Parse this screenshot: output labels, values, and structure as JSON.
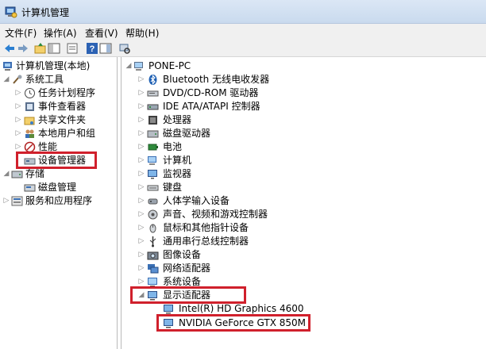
{
  "window": {
    "title": "计算机管理"
  },
  "menu": [
    "文件(F)",
    "操作(A)",
    "查看(V)",
    "帮助(H)"
  ],
  "toolbar": [
    "back-arrow-icon",
    "forward-arrow-icon",
    "up-folder-icon",
    "show-hide-tree-icon",
    "properties-icon",
    "help-icon",
    "view-icon",
    "scan-hardware-icon"
  ],
  "left_tree": [
    {
      "label": "计算机管理(本地)",
      "icon": "computer-management-icon"
    },
    {
      "label": "系统工具",
      "icon": "tools-icon"
    },
    {
      "label": "任务计划程序",
      "icon": "clock-icon"
    },
    {
      "label": "事件查看器",
      "icon": "event-viewer-icon"
    },
    {
      "label": "共享文件夹",
      "icon": "shared-folder-icon"
    },
    {
      "label": "本地用户和组",
      "icon": "users-icon"
    },
    {
      "label": "性能",
      "icon": "performance-icon"
    },
    {
      "label": "设备管理器",
      "icon": "device-manager-icon"
    },
    {
      "label": "存储",
      "icon": "storage-icon"
    },
    {
      "label": "磁盘管理",
      "icon": "disk-management-icon"
    },
    {
      "label": "服务和应用程序",
      "icon": "services-icon"
    }
  ],
  "device_tree": {
    "root": "PONE-PC",
    "categories": [
      "Bluetooth 无线电收发器",
      "DVD/CD-ROM 驱动器",
      "IDE ATA/ATAPI 控制器",
      "处理器",
      "磁盘驱动器",
      "电池",
      "计算机",
      "监视器",
      "键盘",
      "人体学输入设备",
      "声音、视频和游戏控制器",
      "鼠标和其他指针设备",
      "通用串行总线控制器",
      "图像设备",
      "网络适配器",
      "系统设备",
      "显示适配器"
    ],
    "display_adapters": [
      "Intel(R) HD Graphics 4600",
      "NVIDIA GeForce GTX 850M"
    ]
  },
  "colors": {
    "highlight": "#d0202c",
    "title_bar": "#dbe7f5"
  }
}
